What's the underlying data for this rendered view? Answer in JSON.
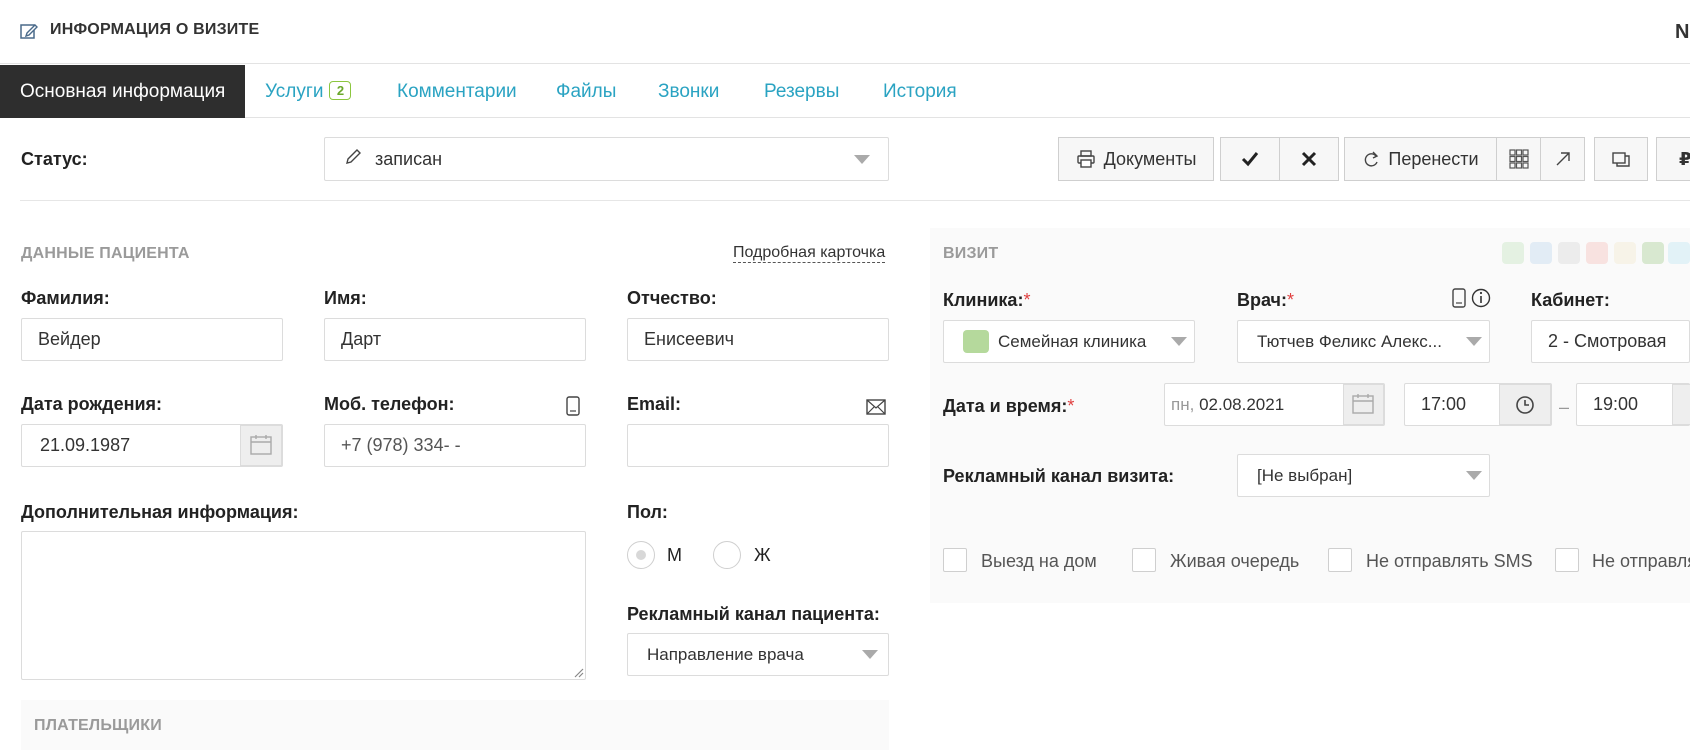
{
  "header": {
    "title": "ИНФОРМАЦИЯ О ВИЗИТЕ",
    "right_text": "N"
  },
  "tabs": [
    {
      "label": "Основная информация"
    },
    {
      "label": "Услуги",
      "badge": "2"
    },
    {
      "label": "Комментарии"
    },
    {
      "label": "Файлы"
    },
    {
      "label": "Звонки"
    },
    {
      "label": "Резервы"
    },
    {
      "label": "История"
    }
  ],
  "status": {
    "label": "Статус:",
    "value": "записан"
  },
  "toolbar": {
    "documents_label": "Документы",
    "reschedule_label": "Перенести"
  },
  "patient": {
    "section_title": "ДАННЫЕ ПАЦИЕНТА",
    "card_link": "Подробная карточка",
    "last_name_label": "Фамилия:",
    "last_name": "Вейдер",
    "first_name_label": "Имя:",
    "first_name": "Дарт",
    "middle_name_label": "Отчество:",
    "middle_name": "Енисеевич",
    "birth_label": "Дата рождения:",
    "birth": "21.09.1987",
    "phone_label": "Моб. телефон:",
    "phone": "+7 (978) 334-  -  ",
    "email_label": "Email:",
    "email": "",
    "extra_label": "Дополнительная информация:",
    "gender_label": "Пол:",
    "gender_m": "М",
    "gender_f": "Ж",
    "ad_label": "Рекламный канал пациента:",
    "ad_value": "Направление врача",
    "payers_title": "ПЛАТЕЛЬЩИКИ"
  },
  "visit": {
    "section_title": "ВИЗИТ",
    "color_tags": [
      "#e4f1e2",
      "#e2ecf5",
      "#ececec",
      "#f8e2e0",
      "#f7f3e8",
      "#d8e8d0",
      "#e2f2f7"
    ],
    "clinic_label": "Клиника:",
    "clinic": "Семейная клиника",
    "clinic_color": "#b5d99c",
    "doctor_label": "Врач:",
    "doctor": "Тютчев Феликс Алекс...",
    "cabinet_label": "Кабинет:",
    "cabinet": "2 - Смотровая",
    "datetime_label": "Дата и время:",
    "date_day": "пн,",
    "date": "02.08.2021",
    "time_from": "17:00",
    "time_sep": "–",
    "time_to": "19:00",
    "ad_label": "Рекламный канал визита:",
    "ad_value": "[Не выбран]",
    "checkboxes": [
      "Выезд на дом",
      "Живая очередь",
      "Не отправлять SMS",
      "Не отправля"
    ]
  }
}
